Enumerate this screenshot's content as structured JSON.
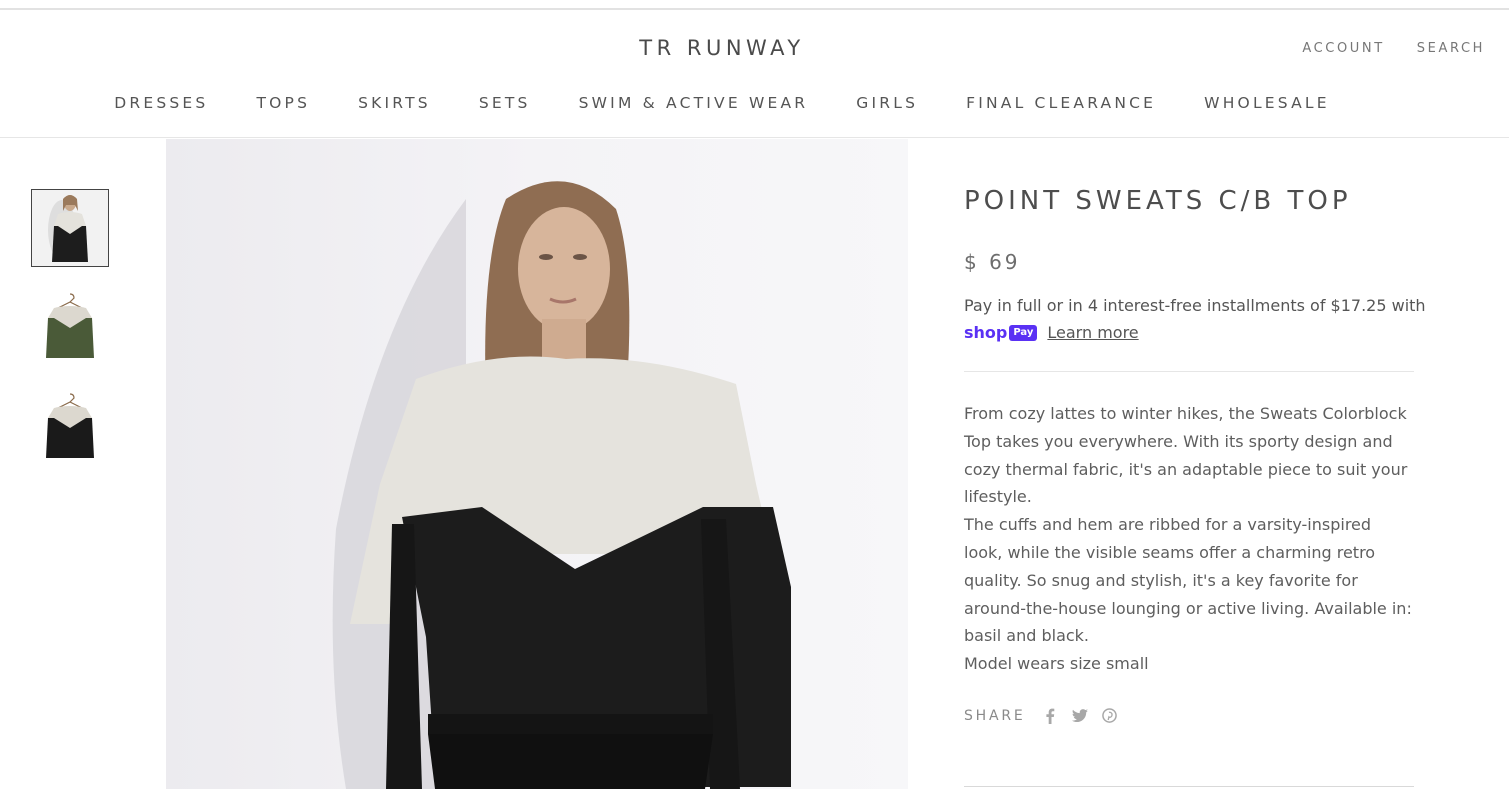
{
  "header": {
    "logo": "TR RUNWAY",
    "account": "ACCOUNT",
    "search": "SEARCH"
  },
  "nav": [
    "DRESSES",
    "TOPS",
    "SKIRTS",
    "SETS",
    "SWIM & ACTIVE WEAR",
    "GIRLS",
    "FINAL CLEARANCE",
    "WHOLESALE"
  ],
  "product": {
    "title": "POINT SWEATS C/B TOP",
    "price": "$ 69",
    "installments_line": "Pay in full or in 4 interest-free installments of $17.25 with",
    "shoppay_text": "shop",
    "shoppay_pill": "Pay",
    "learn_more": "Learn more",
    "description": [
      "From cozy lattes to winter hikes, the Sweats Colorblock Top takes you everywhere. With its sporty design and cozy thermal fabric, it's an adaptable piece to suit your lifestyle.",
      "The cuffs and hem are ribbed for a varsity-inspired look, while the visible seams offer a charming retro quality. So snug and stylish, it's a key favorite for around-the-house lounging or active living. Available in:  basil and black."
    ],
    "model_note": "Model wears size small",
    "share_label": "SHARE"
  },
  "thumbnails": [
    {
      "name": "model front",
      "bottom_color": "#1d1d1d"
    },
    {
      "name": "basil on hanger",
      "bottom_color": "#4a5a38"
    },
    {
      "name": "black on hanger",
      "bottom_color": "#1a1a1a"
    }
  ],
  "colors": {
    "shoppay": "#5a31f4",
    "top_panel": "#e5e3dd",
    "bottom_panel": "#1c1c1c"
  },
  "icons": [
    "facebook-icon",
    "twitter-icon",
    "pinterest-icon"
  ]
}
